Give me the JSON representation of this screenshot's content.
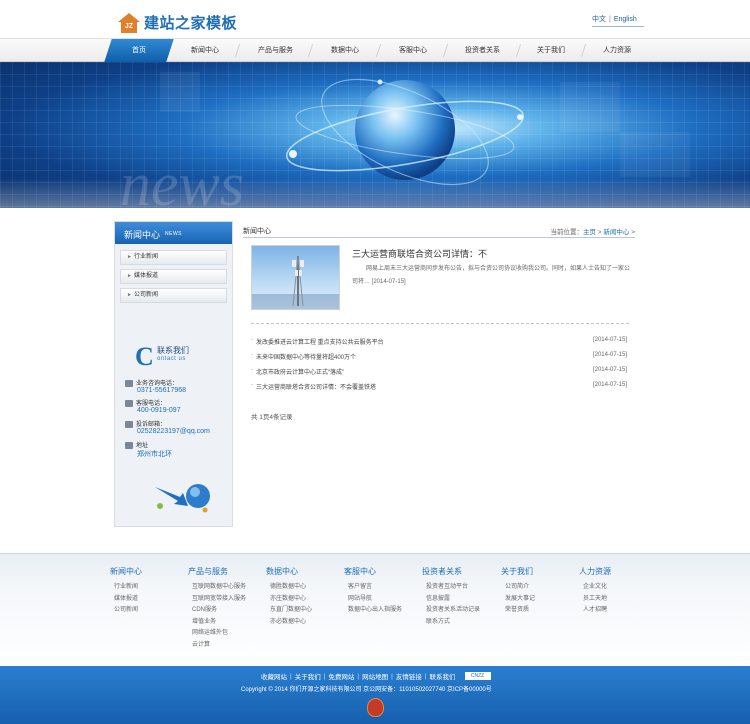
{
  "header": {
    "logo_mark": "JZ",
    "site_title": "建站之家模板",
    "lang_cn": "中文",
    "lang_sep": "|",
    "lang_en": "English"
  },
  "nav": {
    "items": [
      "首页",
      "新闻中心",
      "产品与服务",
      "数据中心",
      "客服中心",
      "投资者关系",
      "关于我们",
      "人力资源"
    ],
    "active_index": 0
  },
  "banner": {
    "word": "news"
  },
  "sidebar": {
    "title_zh": "新闻中心",
    "title_en": "NEWS",
    "menu": [
      "行业新闻",
      "媒体报道",
      "公司新闻"
    ],
    "contact_title_zh": "联系我们",
    "contact_title_en": "ontact us",
    "contact_big_letter": "C",
    "phone_label": "业务咨询电话：",
    "phone_value": "0371-55617968",
    "service_label": "客服电话：",
    "service_value": "400-0919-097",
    "email_label": "投诉邮箱：",
    "email_value": "02528223197@qq.com",
    "address_label": "地址",
    "address_value": "郑州市北环"
  },
  "main": {
    "section_title": "新闻中心",
    "breadcrumb_prefix": "当前位置：",
    "breadcrumb_home": "主页",
    "breadcrumb_sep": ">",
    "breadcrumb_current": "新闻中心",
    "breadcrumb_end": ">",
    "featured_title": "三大运营商联塔合资公司详情：不",
    "featured_desc": "网易上周末三大运营商同步发布公告，拟与合资公司协议收购我公司。同时，如果人士告知了一家公司将… [2014-07-15]",
    "news": [
      {
        "text": "发改委推进云计算工程 重点支持公共云服务平台",
        "date": "[2014-07-15]"
      },
      {
        "text": "未来中国数据中心等待量将超400万个",
        "date": "[2014-07-15]"
      },
      {
        "text": "北京市政府云计算中心正式“落成”",
        "date": "[2014-07-15]"
      },
      {
        "text": "三大运营商联塔合资公司详情：不会覆盖铁塔",
        "date": "[2014-07-15]"
      }
    ],
    "pager": "共 1页4条记录"
  },
  "footer_nav": {
    "columns": [
      {
        "head": "新闻中心",
        "items": [
          "行业新闻",
          "媒体报道",
          "公司新闻"
        ]
      },
      {
        "head": "产品与服务",
        "items": [
          "互联网数据中心服务",
          "互联网宽带接入服务",
          "CDN服务",
          "增值业务",
          "网络运维外包",
          "云计算"
        ]
      },
      {
        "head": "数据中心",
        "items": [
          "德胜数据中心",
          "亦庄数据中心",
          "东直门数据中心",
          "亦必数据中心"
        ]
      },
      {
        "head": "客服中心",
        "items": [
          "客户留言",
          "网站导航",
          "数据中心出入指服务"
        ]
      },
      {
        "head": "投资者关系",
        "items": [
          "投资者互动平台",
          "信息披露",
          "投资者关系活动记录",
          "联系方式"
        ]
      },
      {
        "head": "关于我们",
        "items": [
          "公司简介",
          "发展大事记",
          "荣誉资质"
        ]
      },
      {
        "head": "人力资源",
        "items": [
          "企业文化",
          "员工天地",
          "人才招聘"
        ]
      }
    ]
  },
  "bottom": {
    "links": [
      "收藏网站",
      "关于我们",
      "免费网站",
      "网站地图",
      "友情链接",
      "联系我们"
    ],
    "separator": "|",
    "stat_badge": "CNZZ",
    "copyright": "Copyright © 2014  你们开源之家科技有限公司  京公网安备：11010502027740  京ICP备00000号"
  },
  "colors": {
    "brand_blue": "#1f6fb5",
    "nav_active": "#1a6cbd",
    "logo_orange": "#e0802a",
    "bottom_bar": "#1f6fbf"
  }
}
